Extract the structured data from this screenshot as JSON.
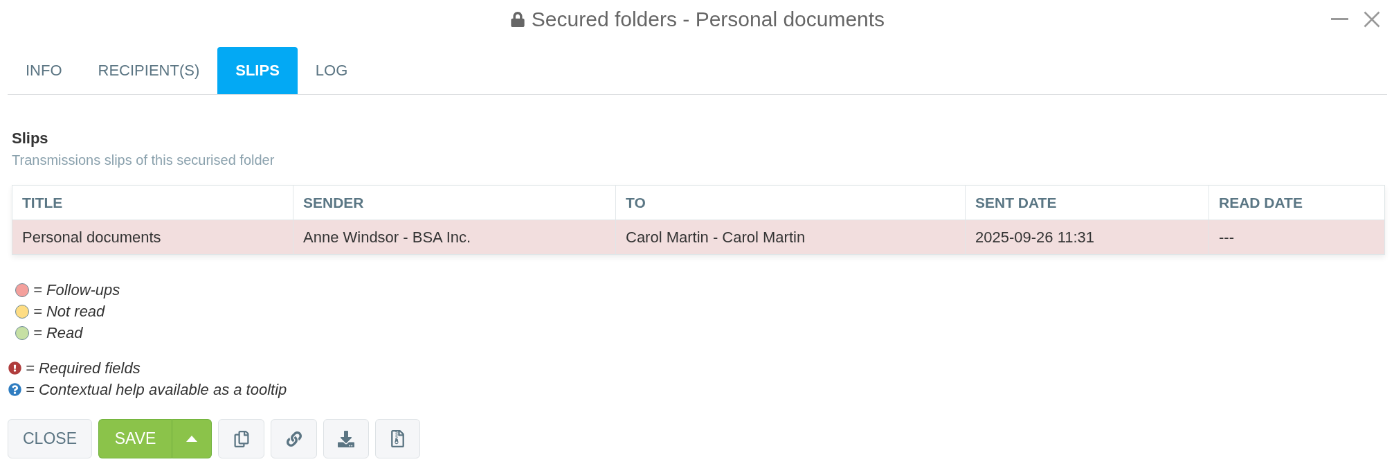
{
  "window": {
    "title": "Secured folders - Personal documents"
  },
  "tabs": [
    {
      "label": "INFO",
      "selected": false
    },
    {
      "label": "RECIPIENT(S)",
      "selected": false
    },
    {
      "label": "SLIPS",
      "selected": true
    },
    {
      "label": "LOG",
      "selected": false
    }
  ],
  "section": {
    "title": "Slips",
    "subtitle": "Transmissions slips of this securised folder"
  },
  "table": {
    "columns": [
      "TITLE",
      "SENDER",
      "TO",
      "SENT DATE",
      "READ DATE"
    ],
    "rows": [
      {
        "color": "#f2dede",
        "cells": [
          "Personal documents",
          "Anne Windsor - BSA Inc.",
          "Carol Martin - Carol Martin",
          "2025-09-26 11:31",
          "---"
        ]
      }
    ]
  },
  "legend": [
    {
      "label": "= Follow-ups",
      "color": "#f4a09c"
    },
    {
      "label": "= Not read",
      "color": "#fedd84"
    },
    {
      "label": "= Read",
      "color": "#c6e0a4"
    }
  ],
  "notes": [
    {
      "kind": "required",
      "label": "= Required fields"
    },
    {
      "kind": "help",
      "label": "= Contextual help available as a tooltip"
    }
  ],
  "buttons": [
    {
      "kind": "plain",
      "label": "CLOSE"
    },
    {
      "kind": "split",
      "label": "SAVE"
    }
  ]
}
